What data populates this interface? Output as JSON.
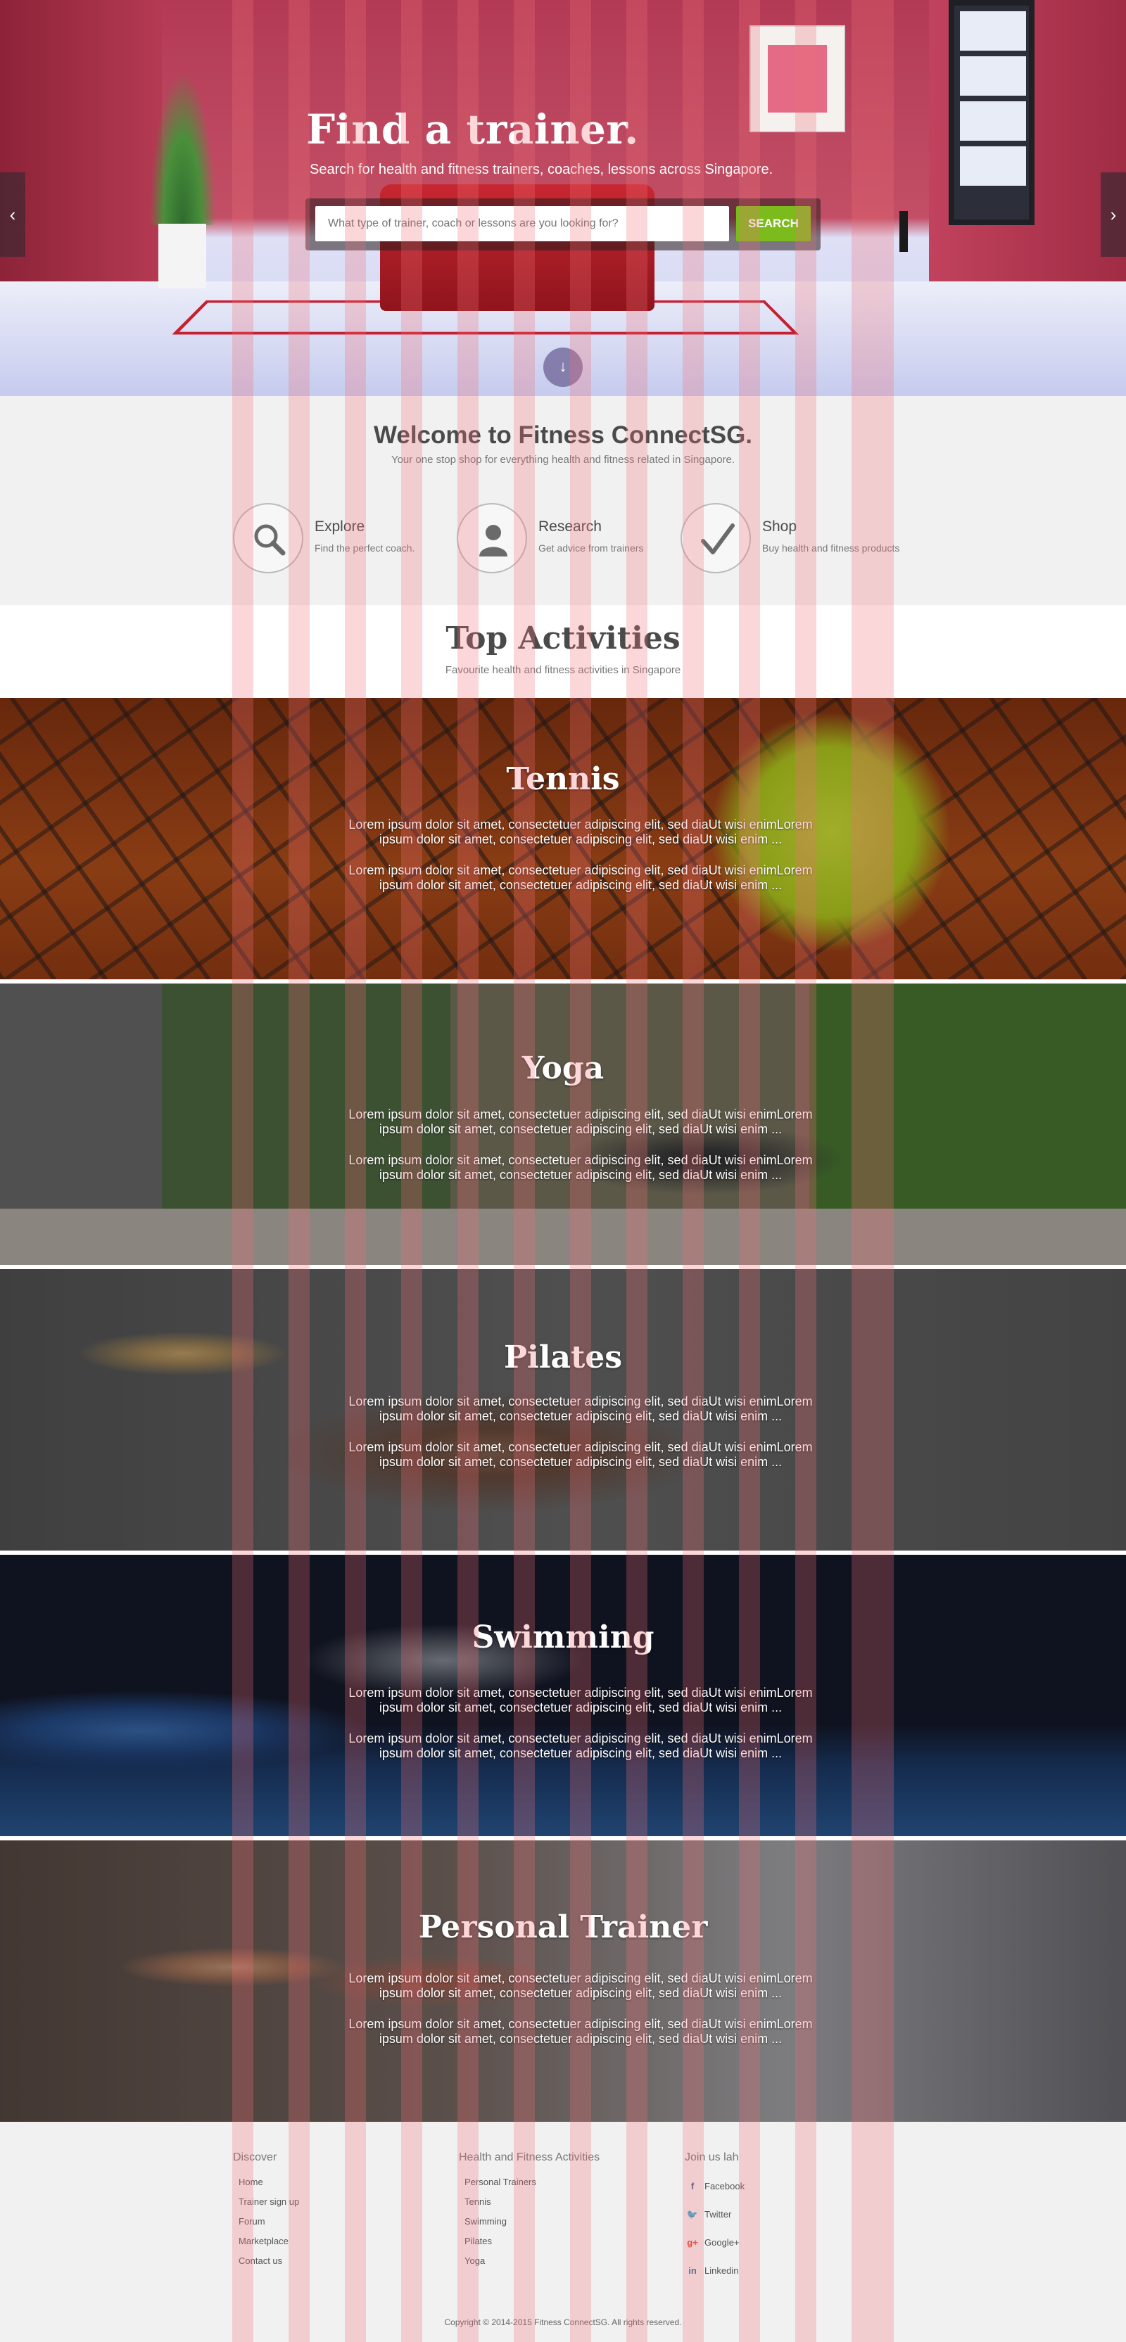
{
  "hero": {
    "title": "Find a trainer.",
    "subtitle": "Search for health and fitness trainers, coaches, lessons across Singapore.",
    "search_placeholder": "What type of trainer, coach or lessons are you looking for?",
    "search_button": "SEARCH",
    "prev_arrow": "‹",
    "next_arrow": "›",
    "scroll_icon": "↓"
  },
  "welcome": {
    "title": "Welcome to Fitness ConnectSG.",
    "subtitle": "Your one stop shop for everything health and fitness related in Singapore.",
    "features": [
      {
        "title": "Explore",
        "desc": "Find the perfect coach.",
        "icon": "search-icon"
      },
      {
        "title": "Research",
        "desc": "Get advice from trainers",
        "icon": "user-icon"
      },
      {
        "title": "Shop",
        "desc": "Buy health and fitness products",
        "icon": "check-icon"
      }
    ]
  },
  "top_activities": {
    "title": "Top Activities",
    "subtitle": "Favourite health and fitness activities in Singapore"
  },
  "activities": [
    {
      "title": "Tennis",
      "p1": "Lorem ipsum dolor sit amet, consectetuer adipiscing elit, sed diaUt wisi enimLorem ipsum dolor sit amet, consectetuer adipiscing elit, sed diaUt wisi enim ...",
      "p2": "Lorem ipsum dolor sit amet, consectetuer adipiscing elit, sed diaUt wisi enimLorem ipsum dolor sit amet, consectetuer adipiscing elit, sed diaUt wisi enim ..."
    },
    {
      "title": "Yoga",
      "p1": "Lorem ipsum dolor sit amet, consectetuer adipiscing elit, sed diaUt wisi enimLorem ipsum dolor sit amet, consectetuer adipiscing elit, sed diaUt wisi enim ...",
      "p2": "Lorem ipsum dolor sit amet, consectetuer adipiscing elit, sed diaUt wisi enimLorem ipsum dolor sit amet, consectetuer adipiscing elit, sed diaUt wisi enim ..."
    },
    {
      "title": "Pilates",
      "p1": "Lorem ipsum dolor sit amet, consectetuer adipiscing elit, sed diaUt wisi enimLorem ipsum dolor sit amet, consectetuer adipiscing elit, sed diaUt wisi enim ...",
      "p2": "Lorem ipsum dolor sit amet, consectetuer adipiscing elit, sed diaUt wisi enimLorem ipsum dolor sit amet, consectetuer adipiscing elit, sed diaUt wisi enim ..."
    },
    {
      "title": "Swimming",
      "p1": "Lorem ipsum dolor sit amet, consectetuer adipiscing elit, sed diaUt wisi enimLorem ipsum dolor sit amet, consectetuer adipiscing elit, sed diaUt wisi enim ...",
      "p2": "Lorem ipsum dolor sit amet, consectetuer adipiscing elit, sed diaUt wisi enimLorem ipsum dolor sit amet, consectetuer adipiscing elit, sed diaUt wisi enim ..."
    },
    {
      "title": "Personal Trainer",
      "p1": "Lorem ipsum dolor sit amet, consectetuer adipiscing elit, sed diaUt wisi enimLorem ipsum dolor sit amet, consectetuer adipiscing elit, sed diaUt wisi enim ...",
      "p2": "Lorem ipsum dolor sit amet, consectetuer adipiscing elit, sed diaUt wisi enimLorem ipsum dolor sit amet, consectetuer adipiscing elit, sed diaUt wisi enim ..."
    }
  ],
  "footer": {
    "discover": {
      "heading": "Discover",
      "links": [
        "Home",
        "Trainer sign up",
        "Forum",
        "Marketplace",
        "Contact us"
      ]
    },
    "activities": {
      "heading": "Health and Fitness Activities",
      "links": [
        "Personal Trainers",
        "Tennis",
        "Swimming",
        "Pilates",
        "Yoga"
      ]
    },
    "social": {
      "heading": "Join us lah",
      "links": [
        {
          "label": "Facebook",
          "icon": "facebook-icon",
          "glyph": "f"
        },
        {
          "label": "Twitter",
          "icon": "twitter-icon",
          "glyph": "🐦"
        },
        {
          "label": "Google+",
          "icon": "googleplus-icon",
          "glyph": "g+"
        },
        {
          "label": "Linkedin",
          "icon": "linkedin-icon",
          "glyph": "in"
        }
      ]
    },
    "copyright": "Copyright © 2014-2015 Fitness ConnectSG.  All rights reserved."
  },
  "colors": {
    "search_button": "#7cbb1c",
    "hero_wall": "#b33a55",
    "section_bg": "#f1f1f1",
    "heading_text": "#4a4a4a"
  }
}
